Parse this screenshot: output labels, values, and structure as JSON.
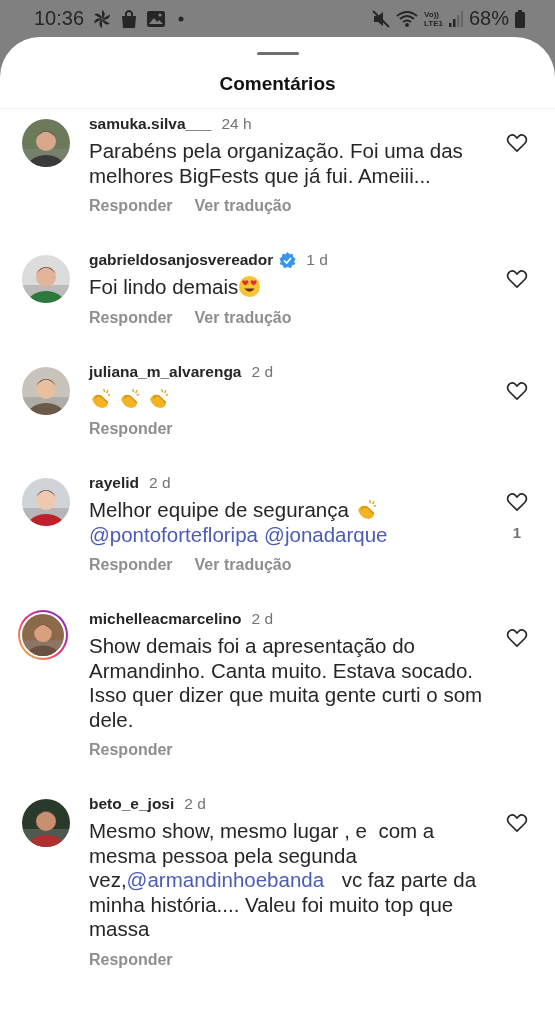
{
  "status_bar": {
    "time": "10:36",
    "network_label": [
      "Vo))",
      "LTE1"
    ],
    "battery": "68%"
  },
  "sheet": {
    "title": "Comentários"
  },
  "comments": [
    {
      "username": "samuka.silva___",
      "verified": false,
      "story": false,
      "time": "24 h",
      "body": [
        {
          "kind": "text",
          "text": "Parabéns pela organização. Foi uma das melhores BigFests que já fui. Ameiii..."
        }
      ],
      "actions": [
        "Responder",
        "Ver tradução"
      ]
    },
    {
      "username": "gabrieldosanjosvereador",
      "verified": true,
      "story": false,
      "time": "1 d",
      "body": [
        {
          "kind": "text",
          "text": "Foi lindo demais"
        },
        {
          "kind": "heart-eyes"
        }
      ],
      "actions": [
        "Responder",
        "Ver tradução"
      ]
    },
    {
      "username": "juliana_m_alvarenga",
      "verified": false,
      "story": false,
      "time": "2 d",
      "body": [
        {
          "kind": "clap"
        },
        {
          "kind": "clap"
        },
        {
          "kind": "clap"
        }
      ],
      "actions": [
        "Responder"
      ]
    },
    {
      "username": "rayelid",
      "verified": false,
      "story": false,
      "time": "2 d",
      "body": [
        {
          "kind": "text",
          "text": "Melhor equipe de segurança "
        },
        {
          "kind": "clap"
        },
        {
          "kind": "mention",
          "text": "@pontofortefloripa"
        },
        {
          "kind": "mention",
          "text": "@jonadarque"
        }
      ],
      "likes": "1",
      "actions": [
        "Responder",
        "Ver tradução"
      ]
    },
    {
      "username": "michelleacmarcelino",
      "verified": false,
      "story": true,
      "time": "2 d",
      "body": [
        {
          "kind": "text",
          "text": "Show demais foi a apresentação do Armandinho. Canta muito. Estava socado. Isso quer dizer que muita gente curti o som dele."
        }
      ],
      "actions": [
        "Responder"
      ]
    },
    {
      "username": "beto_e_josi",
      "verified": false,
      "story": false,
      "time": "2 d",
      "body": [
        {
          "kind": "text",
          "text": "Mesmo show, mesmo lugar , e  com a mesma pessoa pela segunda vez,"
        },
        {
          "kind": "mention",
          "text": "@armandinhoebanda"
        },
        {
          "kind": "text",
          "text": "  vc faz parte da minha história.... Valeu foi muito top que massa"
        }
      ],
      "actions": [
        "Responder"
      ]
    }
  ]
}
